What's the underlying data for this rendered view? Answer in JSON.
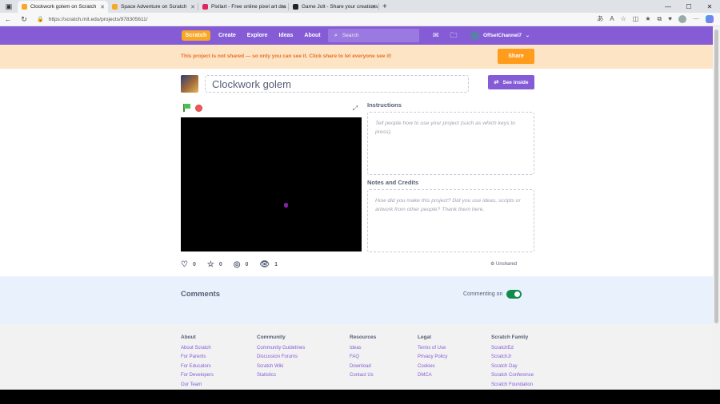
{
  "browser": {
    "tabs": [
      {
        "title": "Clockwork golem on Scratch",
        "active": true,
        "favicon_color": "#f9a825"
      },
      {
        "title": "Space Adventure on Scratch",
        "active": false,
        "favicon_color": "#f9a825"
      },
      {
        "title": "Pixilart - Free online pixel art dra",
        "active": false,
        "favicon_color": "#e0245e"
      },
      {
        "title": "Game Jolt - Share your creations",
        "active": false,
        "favicon_color": "#222222"
      }
    ],
    "url": "https://scratch.mit.edu/projects/978305611/"
  },
  "nav": {
    "logo": "Scratch",
    "links": [
      "Create",
      "Explore",
      "Ideas",
      "About"
    ],
    "search_placeholder": "Search",
    "username": "OffsetChannel7"
  },
  "banner": {
    "message": "This project is not shared — so only you can see it. Click share to let everyone see it!",
    "share_label": "Share"
  },
  "project": {
    "title": "Clockwork golem",
    "see_inside_label": "See inside",
    "stats": {
      "loves": "0",
      "favorites": "0",
      "remixes": "0",
      "views": "1"
    },
    "status": "Unshared"
  },
  "instructions": {
    "label": "Instructions",
    "placeholder": "Tell people how to use your project (such as which keys to press)."
  },
  "notes": {
    "label": "Notes and Credits",
    "placeholder": "How did you make this project? Did you use ideas, scripts or artwork from other people? Thank them here."
  },
  "comments": {
    "heading": "Comments",
    "toggle_label": "Commenting on",
    "toggle_on": true
  },
  "footer": {
    "columns": [
      {
        "heading": "About",
        "links": [
          "About Scratch",
          "For Parents",
          "For Educators",
          "For Developers",
          "Our Team"
        ]
      },
      {
        "heading": "Community",
        "links": [
          "Community Guidelines",
          "Discussion Forums",
          "Scratch Wiki",
          "Statistics"
        ]
      },
      {
        "heading": "Resources",
        "links": [
          "Ideas",
          "FAQ",
          "Download",
          "Contact Us"
        ]
      },
      {
        "heading": "Legal",
        "links": [
          "Terms of Use",
          "Privacy Policy",
          "Cookies",
          "DMCA"
        ]
      },
      {
        "heading": "Scratch Family",
        "links": [
          "ScratchEd",
          "ScratchJr",
          "Scratch Day",
          "Scratch Conference",
          "Scratch Foundation"
        ]
      }
    ]
  },
  "colors": {
    "brand_purple": "#855cd6",
    "share_orange": "#ff9c1b",
    "banner_bg": "#fce4c5",
    "comments_bg": "#e9f1fc"
  }
}
